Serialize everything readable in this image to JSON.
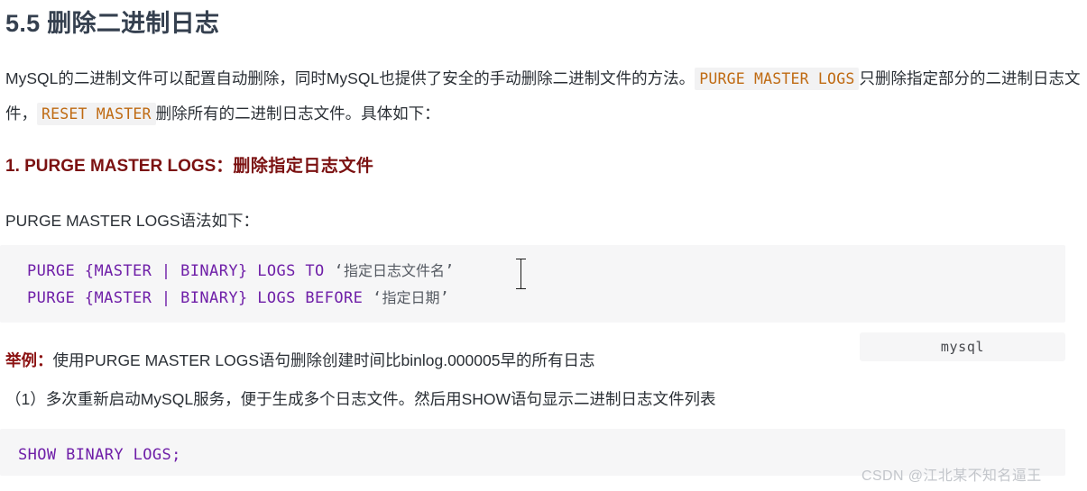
{
  "document": {
    "heading": "5.5 删除二进制日志",
    "intro": {
      "part1": "MySQL的二进制文件可以配置自动删除，同时MySQL也提供了安全的手动删除二进制文件的方法。",
      "code1": "PURGE MASTER LOGS",
      "part2": "只删除指定部分的二进制日志文件，",
      "code2": "RESET MASTER",
      "part3": "删除所有的二进制日志文件。具体如下："
    },
    "subheading": {
      "latin": "1. PURGE MASTER LOGS：",
      "cn": "删除指定日志文件"
    },
    "syntax_lead": "PURGE MASTER LOGS语法如下：",
    "code_syntax": {
      "language_tag": "mysql",
      "line1": {
        "prefix": "PURGE {MASTER | BINARY} LOGS TO ",
        "quote_open": "‘",
        "arg": "指定日志文件名",
        "quote_close": "’"
      },
      "line2": {
        "prefix": "PURGE {MASTER | BINARY} LOGS BEFORE ",
        "quote_open": "‘",
        "arg": "指定日期",
        "quote_close": "’"
      }
    },
    "example": {
      "label": "举例：",
      "text": "使用PURGE MASTER LOGS语句删除创建时间比binlog.000005早的所有日志"
    },
    "step1": "（1）多次重新启动MySQL服务，便于生成多个日志文件。然后用SHOW语句显示二进制日志文件列表",
    "code_show": {
      "line1": "SHOW BINARY LOGS;"
    },
    "watermark": "CSDN @江北某不知名逼王"
  },
  "colors": {
    "heading": "#35404f",
    "subheading": "#7b1111",
    "inline_code_text": "#bf6a12",
    "inline_code_bg": "#f2f2f3",
    "code_block_bg": "#f6f6f7",
    "code_block_text": "#6f1fa8",
    "body_text": "#2b3036",
    "watermark": "#c3c6cb"
  }
}
